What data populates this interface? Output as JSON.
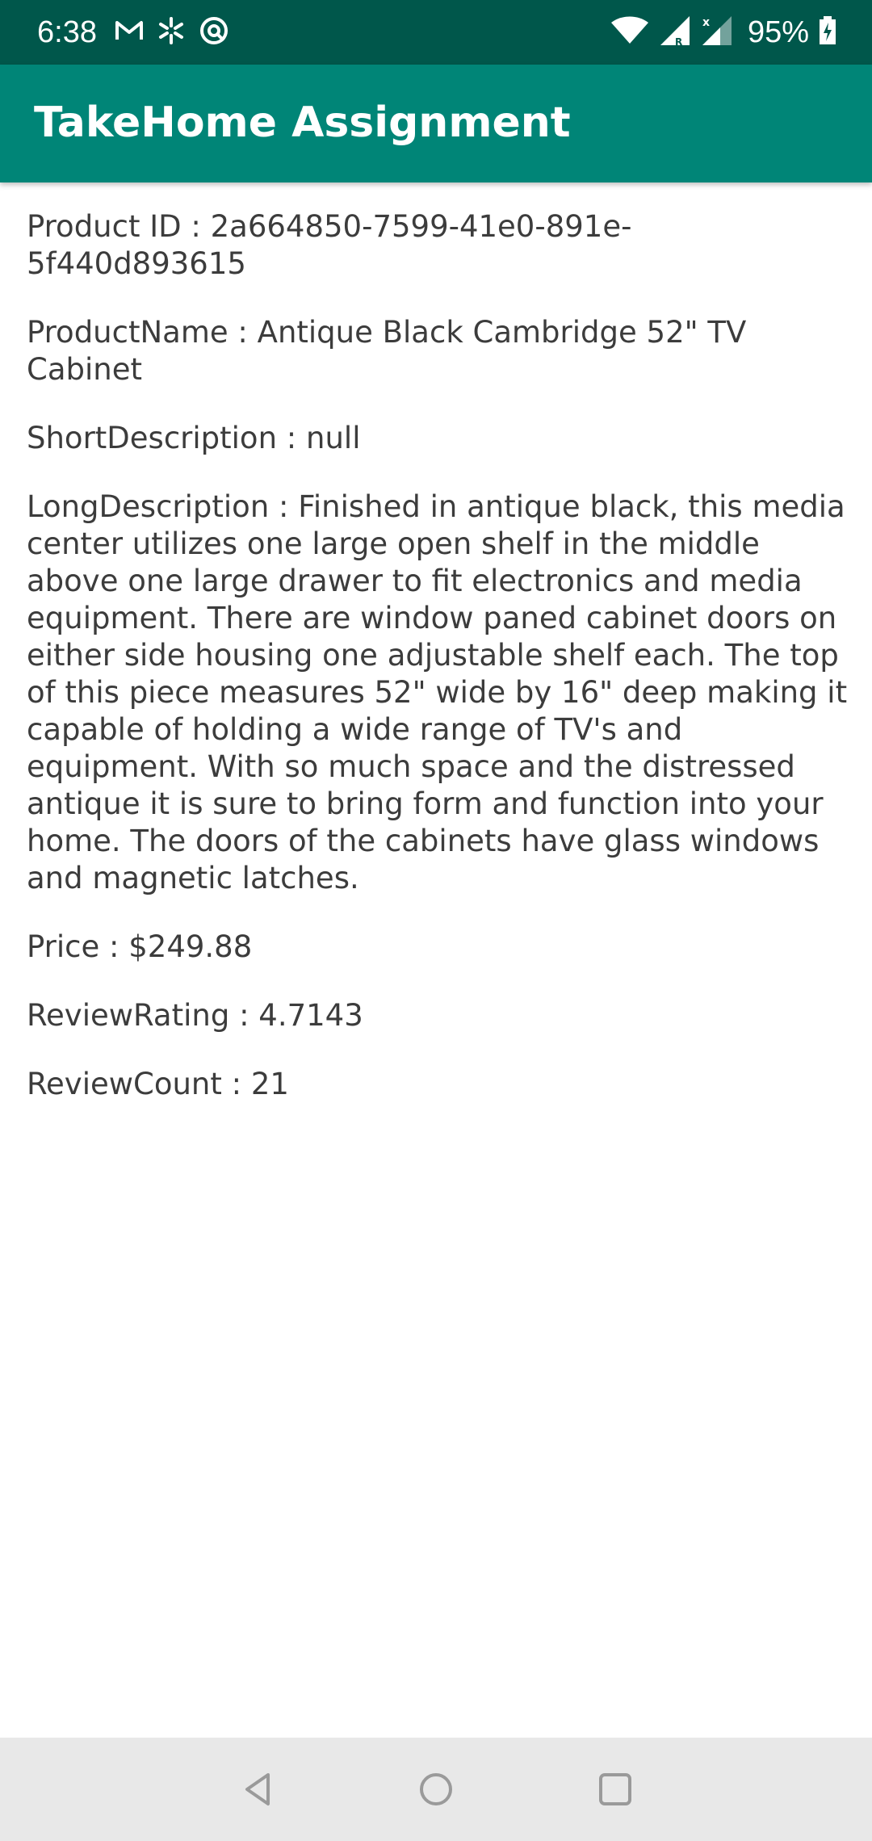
{
  "status_bar": {
    "time": "6:38",
    "battery_percent": "95%",
    "icons": [
      "gmail-icon",
      "walmart-icon",
      "sync-icon",
      "wifi-icon",
      "signal-roaming-icon",
      "signal-icon",
      "battery-charging-icon"
    ],
    "background_color": "#00574b"
  },
  "app_bar": {
    "title": "TakeHome Assignment",
    "background_color": "#008577"
  },
  "product": {
    "id_line": "Product ID : 2a664850-7599-41e0-891e-5f440d893615",
    "name_line": "ProductName : Antique Black Cambridge 52\" TV Cabinet",
    "short_desc_line": "ShortDescription : null",
    "long_desc_line": "LongDescription : Finished in antique black, this media center utilizes one large open shelf in the middle above one large drawer to fit electronics and media equipment. There are window paned cabinet doors on either side housing one adjustable shelf each. The top of this piece measures 52\" wide by 16\" deep making it capable of holding a wide range of TV's and equipment. With so much space and the distressed antique it is sure to bring form and function into your home. The doors of the cabinets have glass windows and magnetic latches.",
    "price_line": "Price : $249.88",
    "rating_line": "ReviewRating : 4.7143",
    "review_count_line": "ReviewCount : 21"
  },
  "nav_bar": {
    "buttons": [
      "back-icon",
      "home-icon",
      "recents-icon"
    ],
    "background_color": "#e8e8e8"
  }
}
